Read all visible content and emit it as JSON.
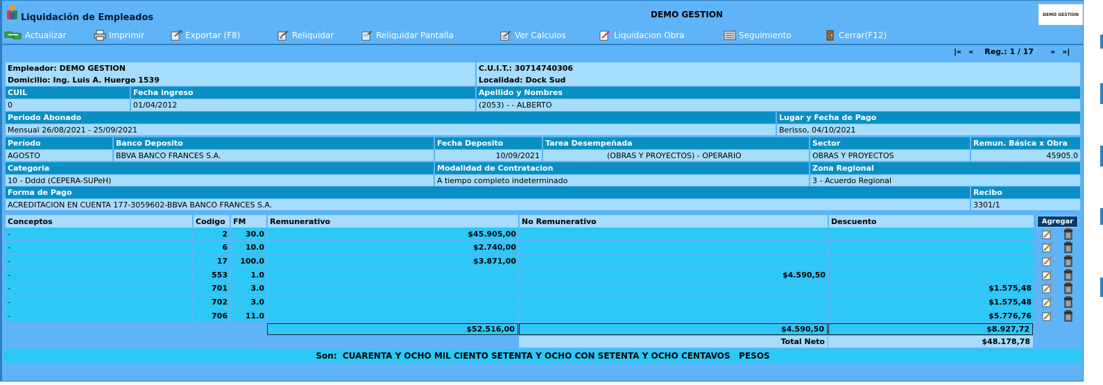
{
  "window": {
    "title": "Liquidación de Empleados",
    "company": "DEMO GESTION",
    "company_logo_text": "DEMO GESTION"
  },
  "toolbar": [
    {
      "label": "Actualizar",
      "icon": "refresh-icon"
    },
    {
      "label": "Imprimir",
      "icon": "printer-icon"
    },
    {
      "label": "Exportar (F8)",
      "icon": "export-icon"
    },
    {
      "label": "Reliquidar",
      "icon": "recalc-icon"
    },
    {
      "label": "Reliquidar Pantalla",
      "icon": "recalc-screen-icon"
    },
    {
      "label": "Ver Calculos",
      "icon": "calc-icon"
    },
    {
      "label": "Liquidacion Obra",
      "icon": "edit-doc-icon"
    },
    {
      "label": "Seguimiento",
      "icon": "track-icon"
    },
    {
      "label": "Cerrar(F12)",
      "icon": "close-door-icon"
    }
  ],
  "nav": {
    "first": "|«",
    "prev": "«",
    "record": "Reg.: 1 / 17",
    "next": "»",
    "last": "»|"
  },
  "employer": {
    "empleador": "Empleador: DEMO GESTION",
    "cuit": "C.U.I.T.: 30714740306",
    "domicilio": "Domicilio: Ing. Luis A. Huergo 1539",
    "localidad": "Localidad: Dock Sud"
  },
  "employee": {
    "cuil_label": "CUIL",
    "cuil": "0",
    "fecha_ingreso_label": "Fecha ingreso",
    "fecha_ingreso": "01/04/2012",
    "nombre_label": "Apellido y Nombres",
    "nombre": "(2053) - - ALBERTO"
  },
  "periodo": {
    "abonado_label": "Periodo Abonado",
    "abonado": "Mensual 26/08/2021 - 25/09/2021",
    "lugar_label": "Lugar y Fecha de Pago",
    "lugar": "Berisso, 04/10/2021"
  },
  "deposito": {
    "periodo_label": "Período",
    "periodo": "AGOSTO",
    "banco_label": "Banco Deposito",
    "banco": "BBVA BANCO FRANCES S.A.",
    "fecha_label": "Fecha Deposito",
    "fecha": "10/09/2021",
    "tarea_label": "Tarea Desempeñada",
    "tarea": "(OBRAS Y PROYECTOS) - OPERARIO",
    "sector_label": "Sector",
    "sector": "OBRAS Y PROYECTOS",
    "remun_label": "Remun. Básica x Obra",
    "remun": "45905.0"
  },
  "categoria": {
    "categoria_label": "Categoria",
    "categoria": "10 - Dddd (CEPERA-SUPeH)",
    "modalidad_label": "Modalidad de Contratacion",
    "modalidad": "A tiempo completo indeterminado",
    "zona_label": "Zona Regional",
    "zona": "3 - Acuerdo Regional"
  },
  "pago": {
    "forma_label": "Forma de Pago",
    "forma": "ACREDITACION EN CUENTA 177-3059602-BBVA BANCO FRANCES S.A.",
    "recibo_label": "Recibo",
    "recibo": "3301/1"
  },
  "concepts": {
    "headers": {
      "concepto": "Conceptos",
      "codigo": "Codigo",
      "fm": "FM",
      "rem": "Remunerativo",
      "norem": "No Remunerativo",
      "desc": "Descuento",
      "add": "Agregar"
    },
    "rows": [
      {
        "concepto": "-",
        "codigo": "2",
        "fm": "30.0",
        "rem": "$45.905,00",
        "norem": "",
        "desc": ""
      },
      {
        "concepto": "-",
        "codigo": "6",
        "fm": "10.0",
        "rem": "$2.740,00",
        "norem": "",
        "desc": ""
      },
      {
        "concepto": "-",
        "codigo": "17",
        "fm": "100.0",
        "rem": "$3.871,00",
        "norem": "",
        "desc": ""
      },
      {
        "concepto": "-",
        "codigo": "553",
        "fm": "1.0",
        "rem": "",
        "norem": "$4.590,50",
        "desc": ""
      },
      {
        "concepto": "-",
        "codigo": "701",
        "fm": "3.0",
        "rem": "",
        "norem": "",
        "desc": "$1.575,48"
      },
      {
        "concepto": "-",
        "codigo": "702",
        "fm": "3.0",
        "rem": "",
        "norem": "",
        "desc": "$1.575,48"
      },
      {
        "concepto": "-",
        "codigo": "706",
        "fm": "11.0",
        "rem": "",
        "norem": "",
        "desc": "$5.776,76"
      }
    ],
    "totals": {
      "rem": "$52.516,00",
      "norem": "$4.590,50",
      "desc": "$8.927,72"
    },
    "neto_label": "Total Neto",
    "neto": "$48.178,78"
  },
  "son": "Son:  CUARENTA Y OCHO MIL CIENTO SETENTA Y OCHO CON SETENTA Y OCHO CENTAVOS   PESOS"
}
